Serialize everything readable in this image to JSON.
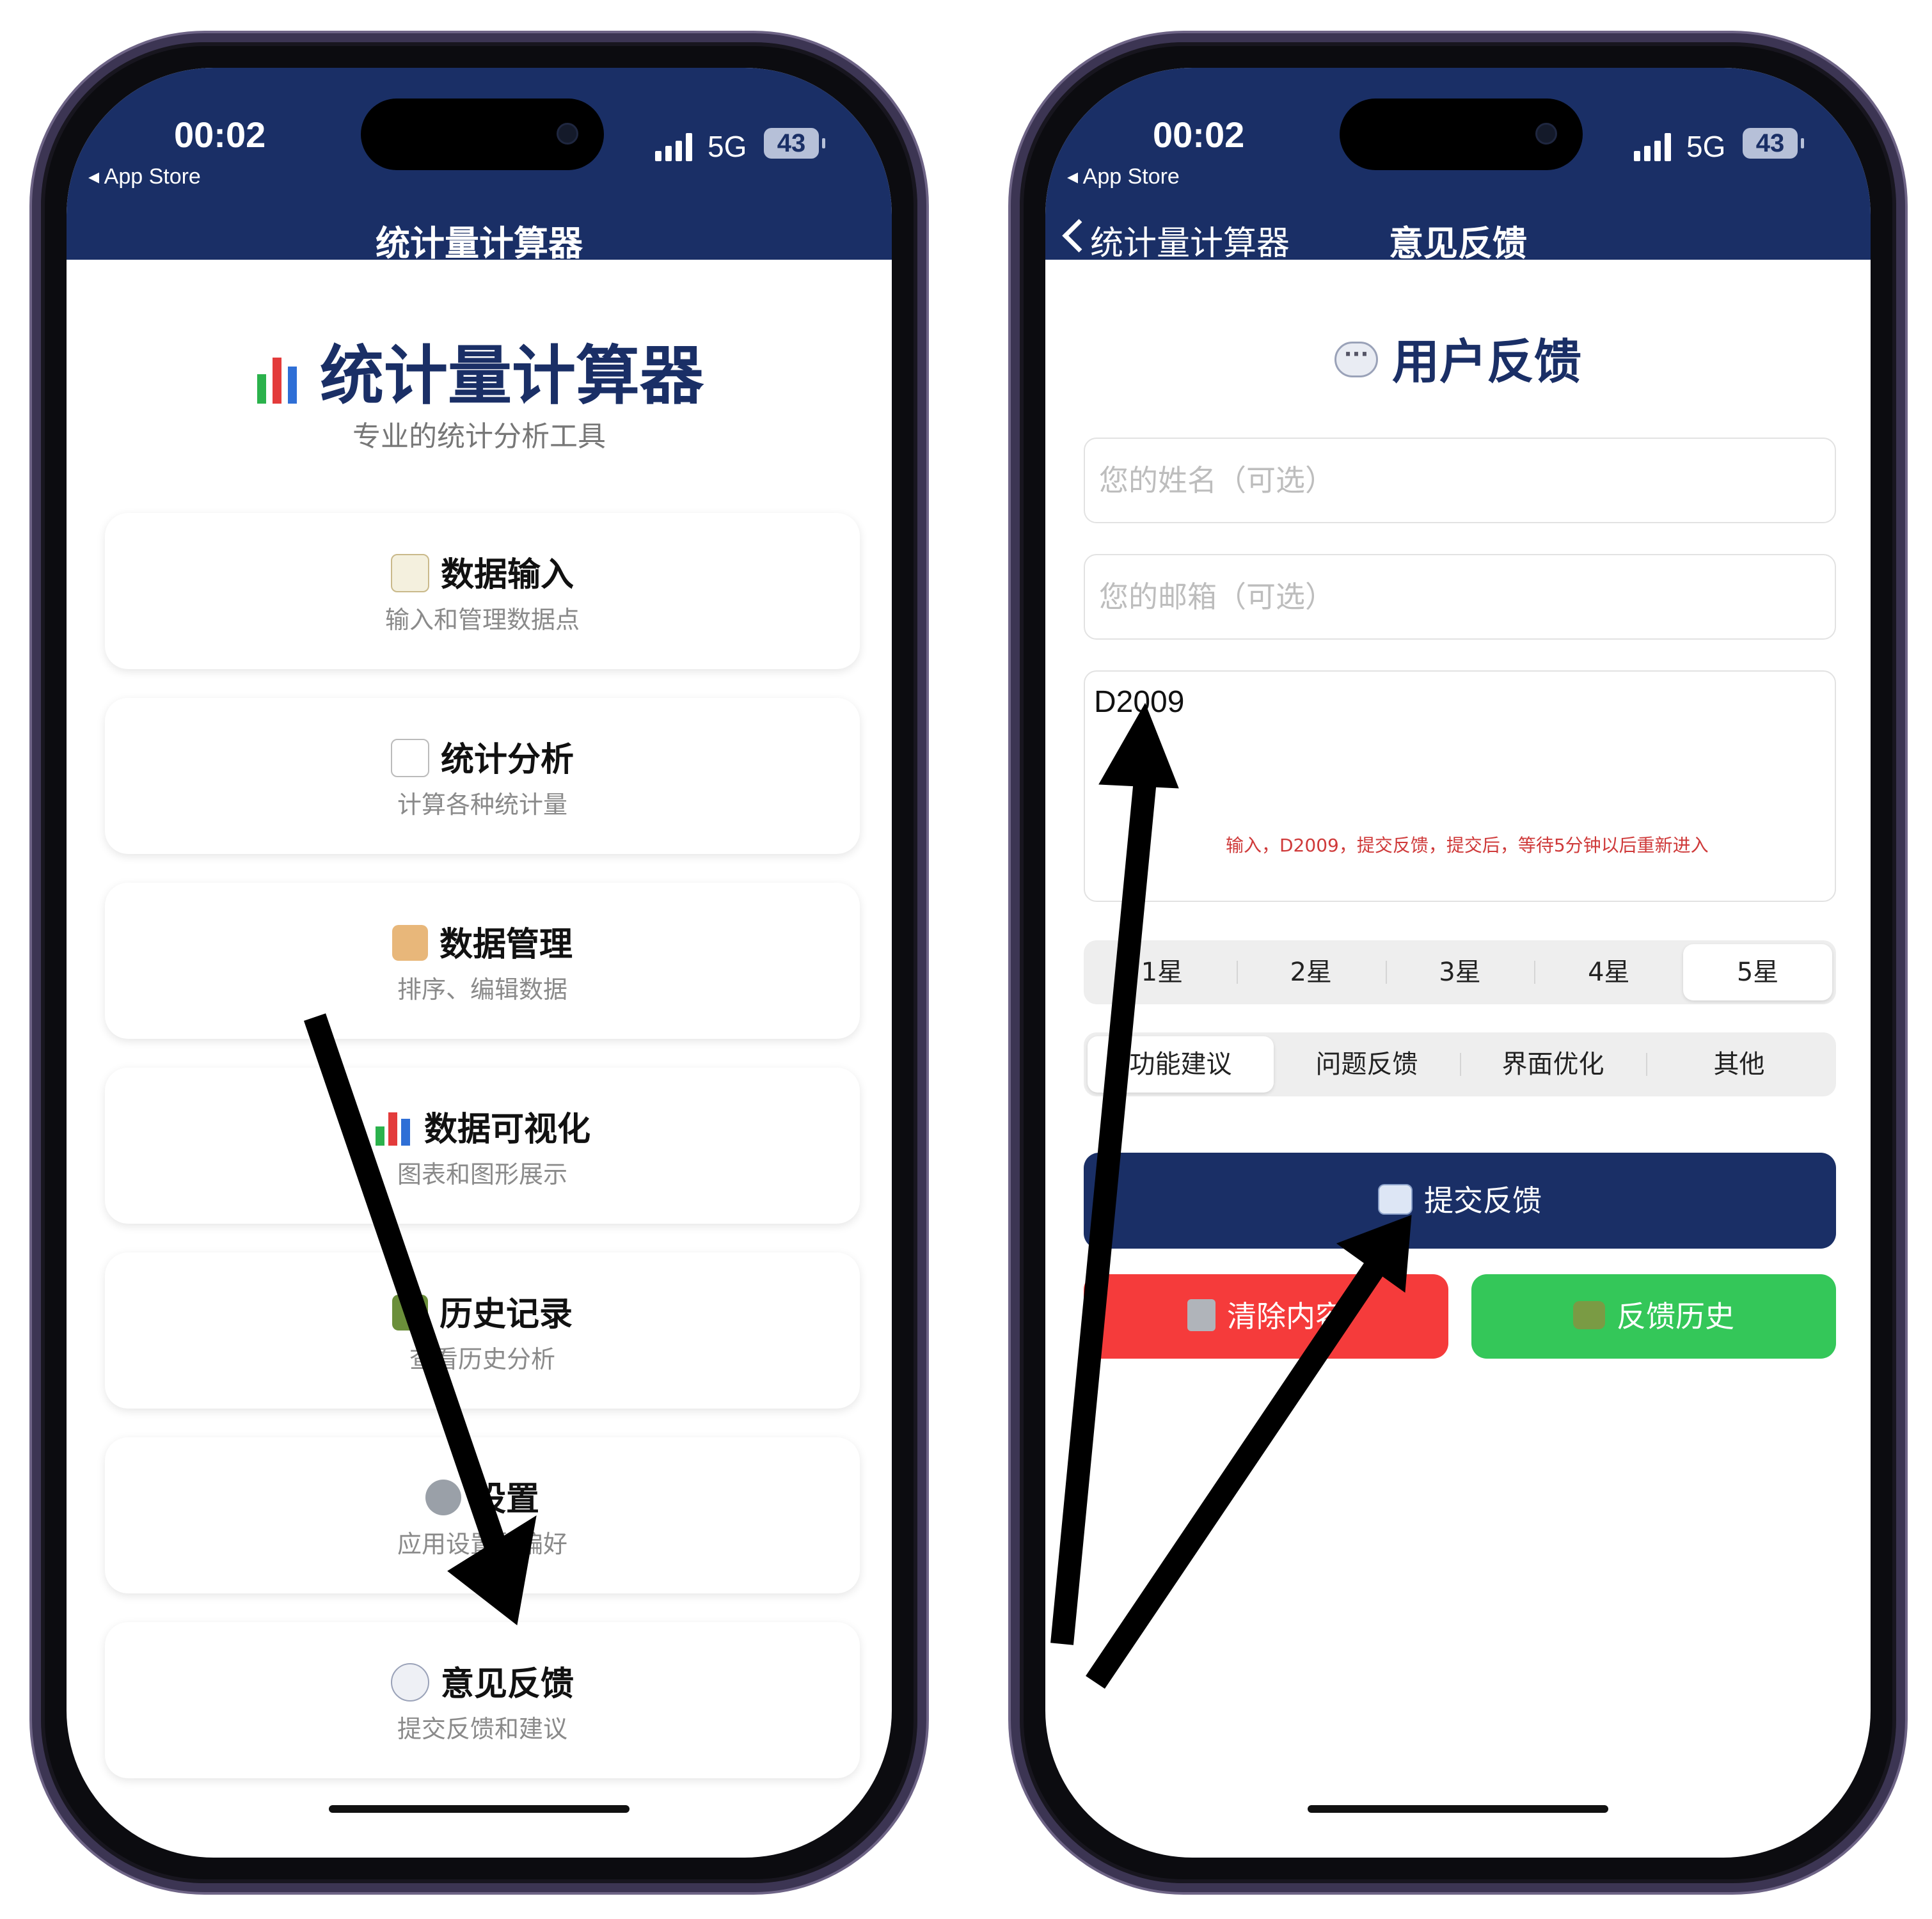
{
  "status_bar": {
    "time": "00:02",
    "back_app": "◂ App Store",
    "network": "5G",
    "battery": "43"
  },
  "left_screen": {
    "nav_title": "统计量计算器",
    "app_title": "统计量计算器",
    "app_subtitle": "专业的统计分析工具",
    "menu_items": [
      {
        "title": "数据输入",
        "subtitle": "输入和管理数据点",
        "icon": "memo-icon"
      },
      {
        "title": "统计分析",
        "subtitle": "计算各种统计量",
        "icon": "chart-increasing-icon"
      },
      {
        "title": "数据管理",
        "subtitle": "排序、编辑数据",
        "icon": "card-file-box-icon"
      },
      {
        "title": "数据可视化",
        "subtitle": "图表和图形展示",
        "icon": "bar-chart-icon"
      },
      {
        "title": "历史记录",
        "subtitle": "查看历史分析",
        "icon": "books-icon"
      },
      {
        "title": "设置",
        "subtitle": "应用设置和偏好",
        "icon": "gear-icon"
      },
      {
        "title": "意见反馈",
        "subtitle": "提交反馈和建议",
        "icon": "speech-bubble-icon"
      }
    ]
  },
  "right_screen": {
    "nav_back": "统计量计算器",
    "nav_title": "意见反馈",
    "page_title": "用户反馈",
    "name_placeholder": "您的姓名（可选）",
    "email_placeholder": "您的邮箱（可选）",
    "message_value": "D2009",
    "annotation": "输入，D2009，提交反馈，提交后，等待5分钟以后重新进入",
    "ratings": [
      "1星",
      "2星",
      "3星",
      "4星",
      "5星"
    ],
    "rating_selected": "5星",
    "categories": [
      "功能建议",
      "问题反馈",
      "界面优化",
      "其他"
    ],
    "category_selected": "功能建议",
    "submit_label": "提交反馈",
    "clear_label": "清除内容",
    "history_label": "反馈历史"
  },
  "colors": {
    "primary": "#1a2f66",
    "danger": "#f53b3b",
    "success": "#34c759",
    "annotation": "#cf3a3a"
  }
}
